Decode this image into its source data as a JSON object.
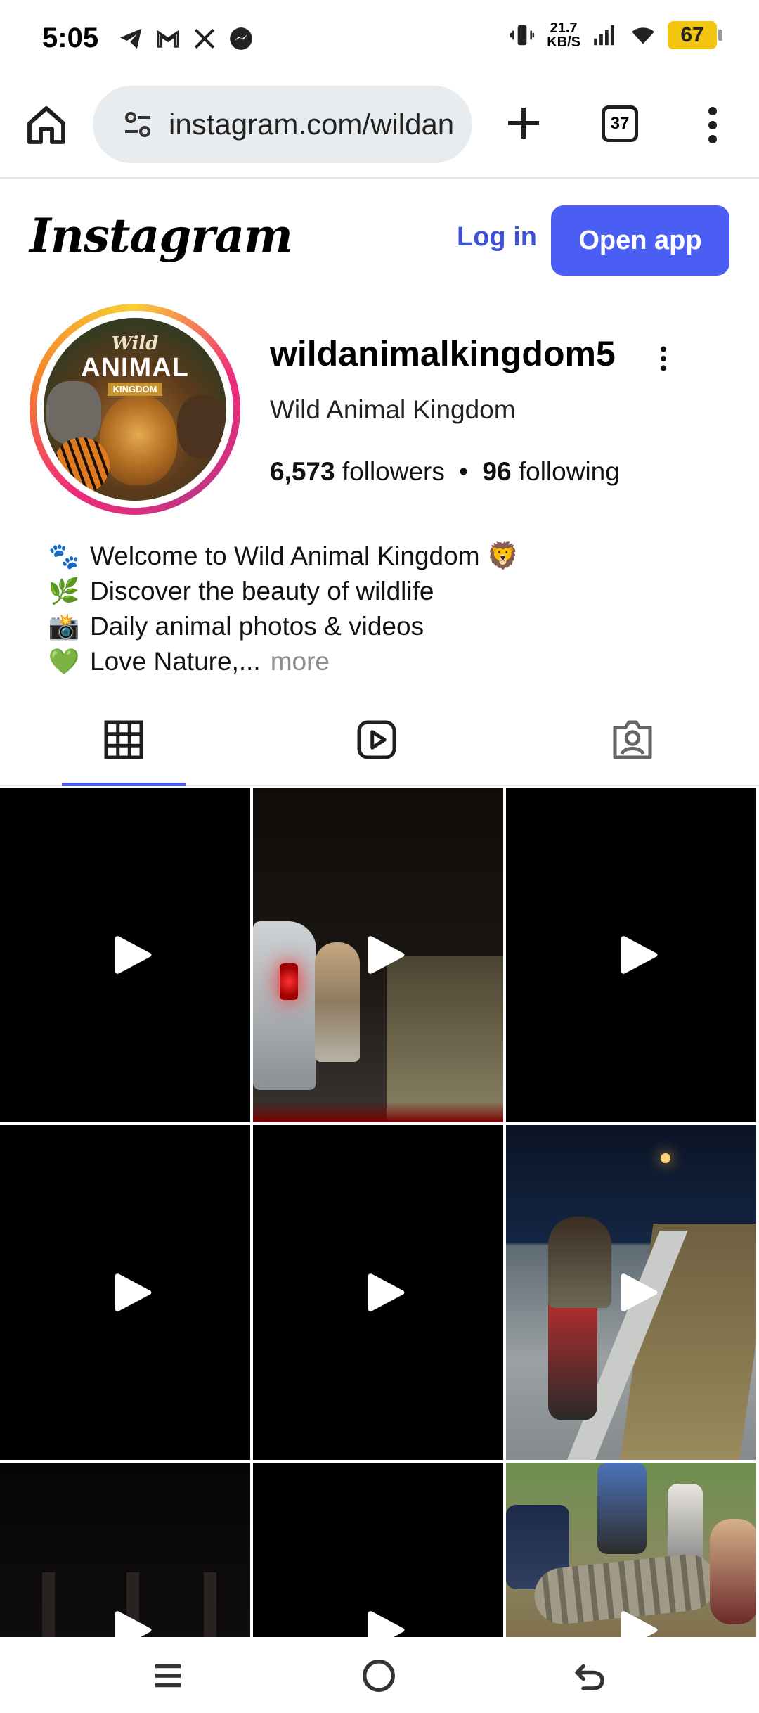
{
  "status_bar": {
    "time": "5:05",
    "speed_value": "21.7",
    "speed_unit": "KB/S",
    "battery": "67",
    "left_icons": [
      "telegram-icon",
      "gmail-icon",
      "x-icon",
      "messenger-icon"
    ],
    "right_icons": [
      "vibrate-icon",
      "signal-icon",
      "wifi-icon",
      "battery-icon"
    ]
  },
  "browser": {
    "url": "instagram.com/wildan",
    "tab_count": "37"
  },
  "instagram": {
    "logo": "Instagram",
    "login_label": "Log in",
    "open_app_label": "Open app",
    "accent": "#4a5ef4"
  },
  "profile": {
    "username": "wildanimalkingdom5",
    "full_name": "Wild Animal Kingdom",
    "followers_count": "6,573",
    "followers_label": "followers",
    "separator": "•",
    "following_count": "96",
    "following_label": "following",
    "avatar": {
      "script_word": "Wild",
      "title_word": "ANIMAL",
      "ribbon_word": "KINGDOM"
    },
    "bio": [
      {
        "emoji": "🐾",
        "text": "Welcome to Wild Animal Kingdom 🦁"
      },
      {
        "emoji": "🌿",
        "text": "Discover the beauty of wildlife"
      },
      {
        "emoji": "📸",
        "text": "Daily animal photos & videos"
      },
      {
        "emoji": "💚",
        "text": "Love Nature,..."
      }
    ],
    "more_label": "more"
  },
  "tabs": [
    "posts-grid",
    "reels",
    "tagged"
  ],
  "grid_posts": [
    {
      "type": "video",
      "scene": "black"
    },
    {
      "type": "video",
      "scene": "night-road-car"
    },
    {
      "type": "video",
      "scene": "black"
    },
    {
      "type": "video",
      "scene": "black"
    },
    {
      "type": "video",
      "scene": "black"
    },
    {
      "type": "video",
      "scene": "night-motorbike-road"
    },
    {
      "type": "video",
      "scene": "dark-forest"
    },
    {
      "type": "video",
      "scene": "black"
    },
    {
      "type": "video",
      "scene": "crocodile-village"
    }
  ]
}
